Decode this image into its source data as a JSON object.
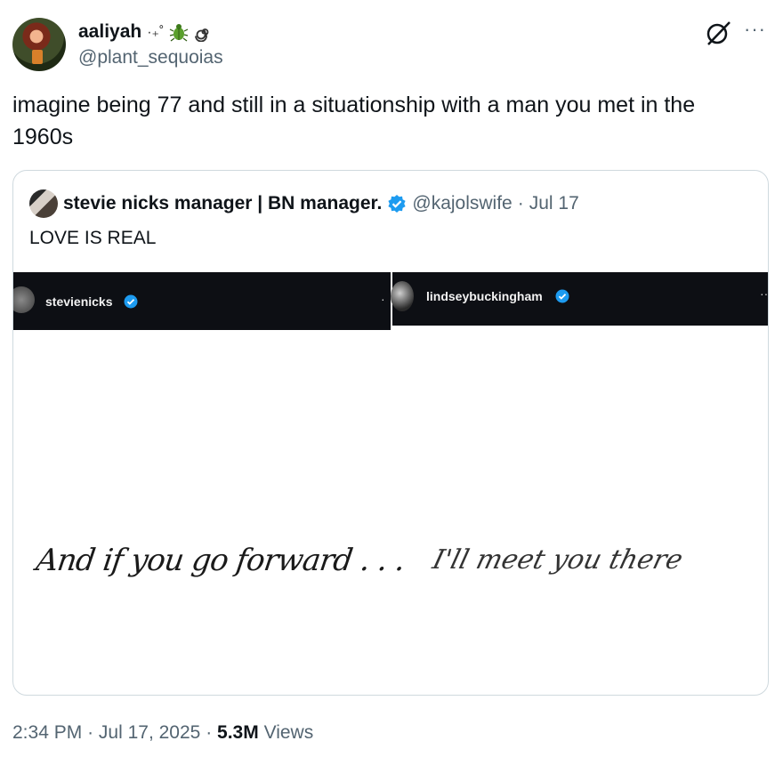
{
  "author": {
    "name": "aaliyah",
    "name_decoration": "·₊˚",
    "handle": "@plant_sequoias"
  },
  "tweet": {
    "text": "imagine being 77 and still in a situationship with a man you met in the 1960s"
  },
  "quote": {
    "name": "stevie nicks manager | BN manager.",
    "handle": "@kajolswife",
    "date": "Jul 17",
    "separator": "·",
    "text": "LOVE IS REAL",
    "left_panel": {
      "username": "stevienicks",
      "handwriting": "And if you go forward . . ."
    },
    "right_panel": {
      "username": "lindseybuckingham",
      "handwriting": "I'll meet you there"
    }
  },
  "footer": {
    "time": "2:34 PM",
    "date": "Jul 17, 2025",
    "views_count": "5.3M",
    "views_label": "Views",
    "separator": "·"
  },
  "colors": {
    "accent_blue": "#1d9bf0",
    "secondary_text": "#536471",
    "border": "#cfd9de"
  },
  "icons": [
    "grok-icon",
    "more-options-icon",
    "verified-badge-icon",
    "beetle-emoji-icon",
    "spiral-emoji-icon"
  ]
}
